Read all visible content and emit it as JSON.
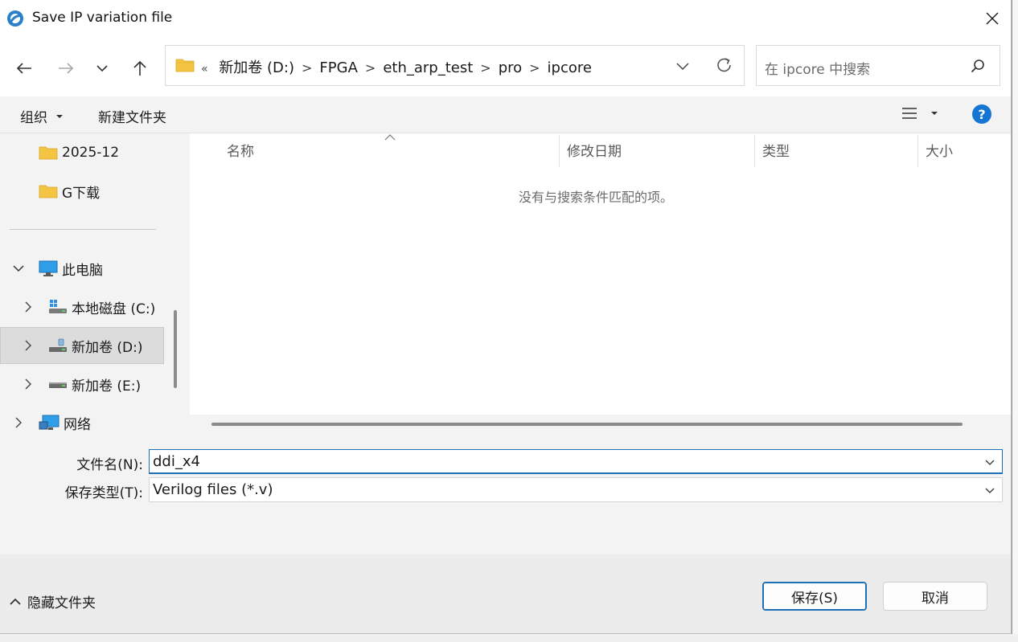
{
  "window": {
    "title": "Save IP variation file"
  },
  "nav": {
    "breadcrumb_prefix": "«",
    "breadcrumbs": [
      "新加卷 (D:)",
      "FPGA",
      "eth_arp_test",
      "pro",
      "ipcore"
    ],
    "search_placeholder": "在 ipcore 中搜索"
  },
  "commandbar": {
    "organize": "组织",
    "new_folder": "新建文件夹"
  },
  "sidebar": {
    "quick_items": [
      "2025-12",
      "G下载"
    ],
    "this_pc": "此电脑",
    "drives": [
      "本地磁盘 (C:)",
      "新加卷 (D:)",
      "新加卷 (E:)"
    ],
    "network": "网络",
    "selected": "新加卷 (D:)"
  },
  "filelist": {
    "columns": [
      "名称",
      "修改日期",
      "类型",
      "大小"
    ],
    "empty_message": "没有与搜索条件匹配的项。"
  },
  "form": {
    "filename_label": "文件名(N):",
    "filename_value": "ddi_x4",
    "filetype_label": "保存类型(T):",
    "filetype_value": "Verilog files (*.v)"
  },
  "footer": {
    "hide_folders": "隐藏文件夹",
    "save_button": "保存(S)",
    "cancel_button": "取消"
  },
  "colors": {
    "accent": "#1d6fb8",
    "help": "#1575d3",
    "folder": "#f4c542"
  }
}
